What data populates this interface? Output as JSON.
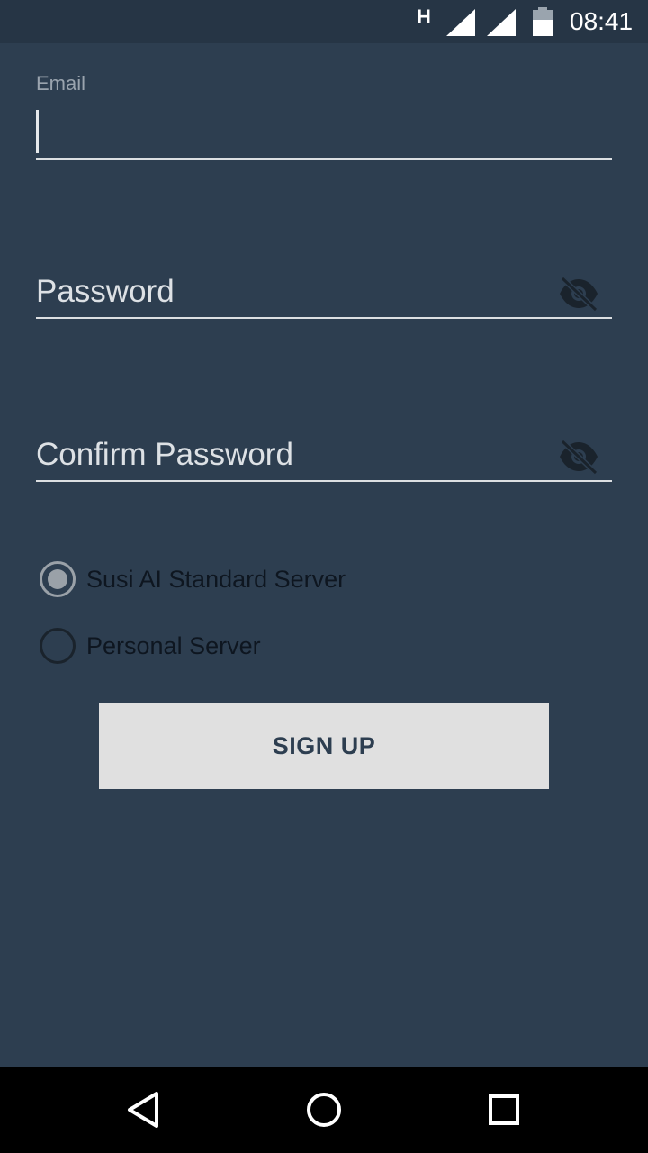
{
  "status_bar": {
    "network_type": "H",
    "time": "08:41",
    "icons": [
      "signal-icon",
      "signal-icon",
      "battery-icon"
    ]
  },
  "form": {
    "email": {
      "label": "Email",
      "value": ""
    },
    "password": {
      "placeholder": "Password",
      "value": "",
      "toggle_icon": "visibility-off-icon"
    },
    "confirm_password": {
      "placeholder": "Confirm Password",
      "value": "",
      "toggle_icon": "visibility-off-icon"
    },
    "server_options": [
      {
        "label": "Susi AI Standard Server",
        "selected": true
      },
      {
        "label": "Personal Server",
        "selected": false
      }
    ],
    "signup_label": "SIGN UP"
  },
  "nav_bar": {
    "icons": [
      "back-icon",
      "home-icon",
      "recents-icon"
    ]
  },
  "colors": {
    "background": "#2d3e50",
    "status_bar": "#263545",
    "button": "#e0e0e0",
    "button_text": "#2d3e50"
  }
}
